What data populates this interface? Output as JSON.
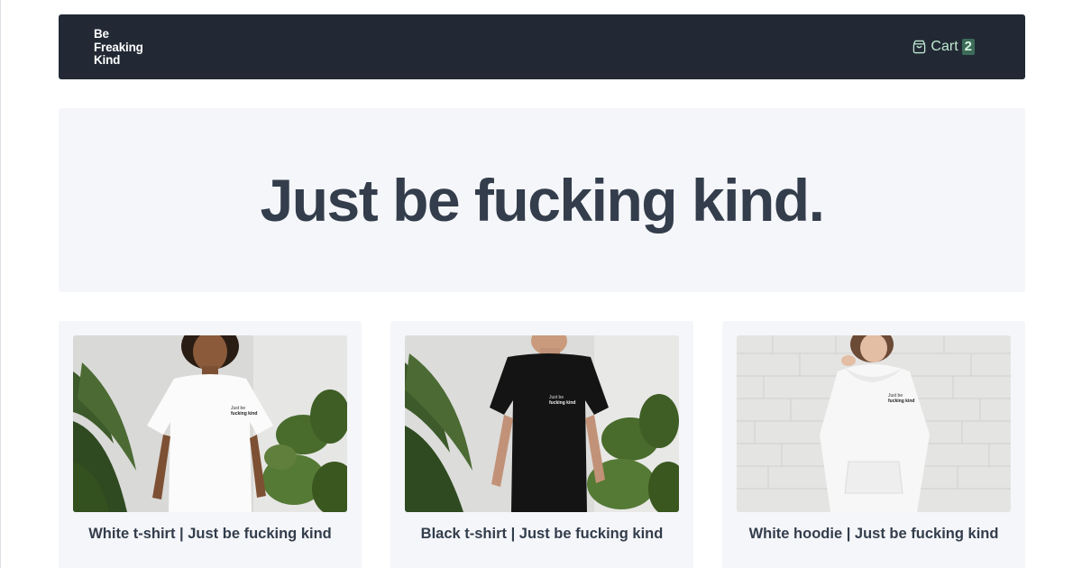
{
  "brand": {
    "logo_lines": [
      "Be",
      "Freaking",
      "Kind"
    ]
  },
  "nav": {
    "cart_label": "Cart",
    "cart_count": "2",
    "cart_icon": "shopping-bag-icon"
  },
  "hero": {
    "headline": "Just be fucking kind."
  },
  "products": [
    {
      "title": "White t-shirt | Just be fucking kind",
      "print_lines": [
        "Just be",
        "fucking kind"
      ]
    },
    {
      "title": "Black t-shirt | Just be fucking kind",
      "print_lines": [
        "Just be",
        "fucking kind"
      ]
    },
    {
      "title": "White hoodie | Just be fucking kind",
      "print_lines": [
        "Just be",
        "fucking kind"
      ]
    }
  ],
  "colors": {
    "header_bg": "#222935",
    "cart_text": "#bfe9cf",
    "badge_bg": "#3c6b58",
    "panel_bg": "#f5f6fa",
    "heading": "#333d4b"
  }
}
